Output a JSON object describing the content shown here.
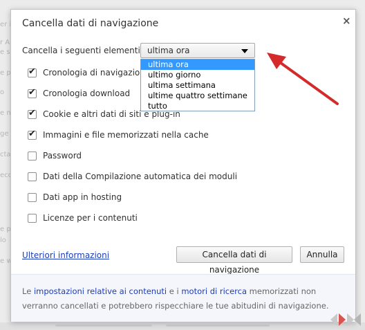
{
  "background": {
    "fragments": [
      "er il",
      "r A",
      "e s",
      "e p",
      "o",
      "e n",
      "ge",
      "ctati",
      "ecc",
      "e pe",
      "lo",
      "e w"
    ]
  },
  "dialog": {
    "title": "Cancella dati di navigazione",
    "close_symbol": "×",
    "select_label": "Cancella i seguenti elementi da:",
    "select_value": "ultima ora",
    "dropdown_options": [
      "ultima ora",
      "ultimo giorno",
      "ultima settimana",
      "ultime quattro settimane",
      "tutto"
    ],
    "selected_option_index": 0,
    "checkboxes": [
      {
        "label": "Cronologia di navigazione",
        "checked": true
      },
      {
        "label": "Cronologia download",
        "checked": true
      },
      {
        "label": "Cookie e altri dati di siti e plug-in",
        "checked": true
      },
      {
        "label": "Immagini e file memorizzati nella cache",
        "checked": true
      },
      {
        "label": "Password",
        "checked": false
      },
      {
        "label": "Dati della Compilazione automatica dei moduli",
        "checked": false
      },
      {
        "label": "Dati app in hosting",
        "checked": false
      },
      {
        "label": "Licenze per i contenuti",
        "checked": false
      }
    ],
    "more_info_link": "Ulteriori informazioni",
    "clear_button": "Cancella dati di navigazione",
    "cancel_button": "Annulla",
    "footer": {
      "text_1": "Le ",
      "link_1": "impostazioni relative ai contenuti",
      "text_2": " e i ",
      "link_2": "motori di ricerca",
      "text_3": " memorizzati non verranno cancellati e potrebbero rispecchiare le tue abitudini di navigazione."
    }
  },
  "colors": {
    "accent_link": "#1a3cbd",
    "selection": "#3399ff",
    "annotation_arrow": "#d42a2a"
  }
}
